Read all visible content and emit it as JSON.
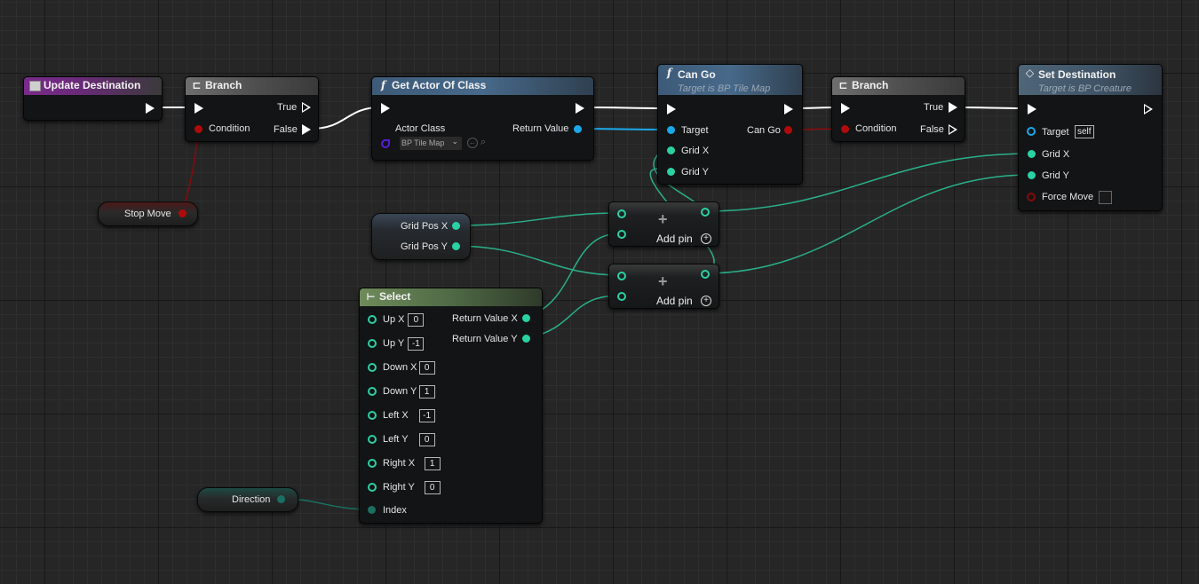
{
  "nodes": {
    "update_destination": {
      "title": "Update Destination"
    },
    "branch1": {
      "title": "Branch",
      "condition": "Condition",
      "true": "True",
      "false": "False"
    },
    "stop_move": {
      "label": "Stop Move"
    },
    "get_actor": {
      "title": "Get Actor Of Class",
      "actor_class_label": "Actor Class",
      "actor_class_value": "BP Tile Map",
      "return_value": "Return Value"
    },
    "can_go": {
      "title": "Can Go",
      "subtitle": "Target is BP Tile Map",
      "target": "Target",
      "grid_x": "Grid X",
      "grid_y": "Grid Y",
      "can_go": "Can Go"
    },
    "branch2": {
      "title": "Branch",
      "condition": "Condition",
      "true": "True",
      "false": "False"
    },
    "set_destination": {
      "title": "Set Destination",
      "subtitle": "Target is BP Creature",
      "target": "Target",
      "target_value": "self",
      "grid_x": "Grid X",
      "grid_y": "Grid Y",
      "force_move": "Force Move"
    },
    "grid_pos": {
      "x": "Grid Pos X",
      "y": "Grid Pos Y"
    },
    "add1": {
      "symbol": "+",
      "add_pin": "Add pin"
    },
    "add2": {
      "symbol": "+",
      "add_pin": "Add pin"
    },
    "select": {
      "title": "Select",
      "inputs": [
        {
          "label": "Up X",
          "value": "0"
        },
        {
          "label": "Up Y",
          "value": "-1"
        },
        {
          "label": "Down X",
          "value": "0"
        },
        {
          "label": "Down Y",
          "value": "1"
        },
        {
          "label": "Left X",
          "value": "-1"
        },
        {
          "label": "Left Y",
          "value": "0"
        },
        {
          "label": "Right X",
          "value": "1"
        },
        {
          "label": "Right Y",
          "value": "0"
        }
      ],
      "index": "Index",
      "return_x": "Return Value X",
      "return_y": "Return Value Y"
    },
    "direction": {
      "label": "Direction"
    }
  },
  "colors": {
    "exec": "#ffffff",
    "float_int": "#2ad1a3",
    "bool": "#b00a0a",
    "object": "#1aa8e8",
    "class": "#5a1ad8"
  }
}
